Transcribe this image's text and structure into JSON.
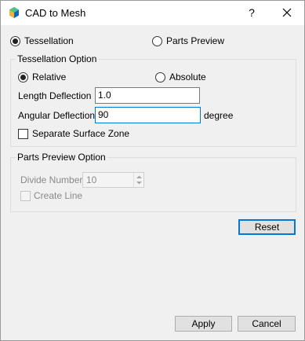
{
  "window": {
    "title": "CAD to Mesh",
    "help_label": "?",
    "icons": {
      "app": "cad-mesh-app-icon",
      "close": "close-icon"
    }
  },
  "mode": {
    "tessellation_label": "Tessellation",
    "parts_preview_label": "Parts Preview",
    "selected": "Tessellation"
  },
  "tessellation_option": {
    "title": "Tessellation Option",
    "relative_label": "Relative",
    "absolute_label": "Absolute",
    "selected": "Relative",
    "length_deflection_label": "Length Deflection",
    "length_deflection_value": "1.0",
    "angular_deflection_label": "Angular Deflection",
    "angular_deflection_value": "90",
    "angular_unit": "degree",
    "separate_surface_zone_label": "Separate Surface Zone",
    "separate_surface_zone_checked": false
  },
  "parts_preview_option": {
    "title": "Parts Preview Option",
    "divide_number_label": "Divide Number",
    "divide_number_value": "10",
    "create_line_label": "Create Line",
    "create_line_checked": false
  },
  "buttons": {
    "reset": "Reset",
    "apply": "Apply",
    "cancel": "Cancel"
  },
  "colors": {
    "focus_accent": "#0078d7",
    "window_bg": "#f0f0f0",
    "titlebar_bg": "#ffffff"
  }
}
